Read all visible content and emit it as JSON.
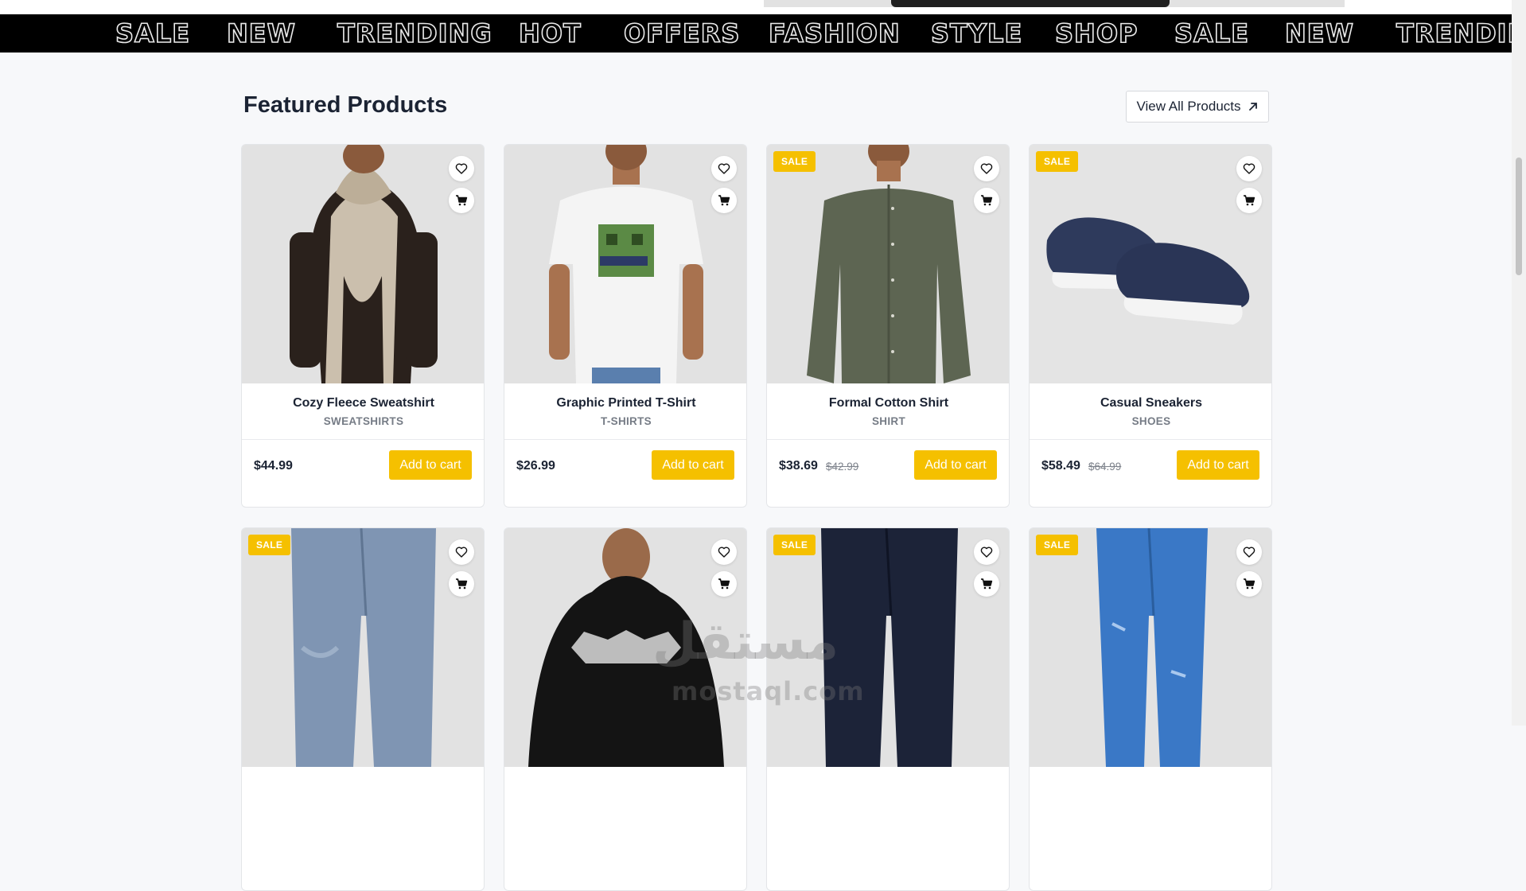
{
  "marquee": {
    "words": [
      "SALE",
      "NEW",
      "TRENDING",
      "HOT",
      "OFFERS",
      "FASHION",
      "STYLE",
      "SHOP",
      "SALE",
      "NEW",
      "TRENDING"
    ]
  },
  "section": {
    "title": "Featured Products",
    "view_all_label": "View All Products"
  },
  "products": [
    {
      "name": "Cozy Fleece Sweatshirt",
      "category": "SWEATSHIRTS",
      "price": "$44.99",
      "old_price": "",
      "sale": false,
      "add_label": "Add to cart",
      "image": "hoodie-beige-brown"
    },
    {
      "name": "Graphic Printed T-Shirt",
      "category": "T-SHIRTS",
      "price": "$26.99",
      "old_price": "",
      "sale": false,
      "add_label": "Add to cart",
      "image": "tshirt-white-graphic"
    },
    {
      "name": "Formal Cotton Shirt",
      "category": "SHIRT",
      "price": "$38.69",
      "old_price": "$42.99",
      "sale": true,
      "badge": "SALE",
      "add_label": "Add to cart",
      "image": "shirt-olive"
    },
    {
      "name": "Casual Sneakers",
      "category": "SHOES",
      "price": "$58.49",
      "old_price": "$64.99",
      "sale": true,
      "badge": "SALE",
      "add_label": "Add to cart",
      "image": "sneakers-navy"
    },
    {
      "sale": true,
      "badge": "SALE",
      "image": "jeans-light-wash"
    },
    {
      "sale": false,
      "image": "hoodie-black-believe"
    },
    {
      "sale": true,
      "badge": "SALE",
      "image": "jeans-dark-wash"
    },
    {
      "sale": true,
      "badge": "SALE",
      "image": "jeans-bright-blue"
    }
  ],
  "watermark": {
    "arabic": "مستقل",
    "latin": "mostaql.com"
  },
  "colors": {
    "accent": "#f5c000",
    "text": "#1b2333",
    "muted": "#767c86",
    "background": "#f7f8fa"
  }
}
